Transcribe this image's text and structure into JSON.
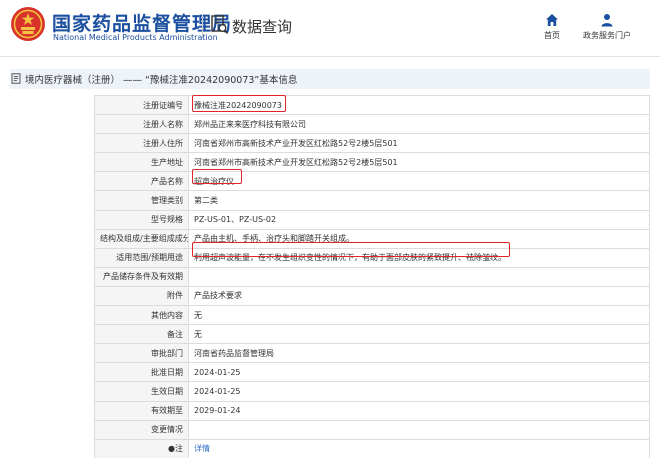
{
  "header": {
    "org_cn": "国家药品监督管理局",
    "org_en": "National Medical Products Administration",
    "query_title": "数据查询",
    "nav": [
      {
        "label": "首页",
        "icon": "home-icon"
      },
      {
        "label": "政务服务门户",
        "icon": "user-icon"
      }
    ]
  },
  "title_bar": {
    "category": "境内医疗器械（注册）",
    "separator": "——",
    "record": "“豫械注准20242090073”",
    "suffix": "基本信息"
  },
  "rows": [
    {
      "label": "注册证编号",
      "value": "豫械注准20242090073"
    },
    {
      "label": "注册人名称",
      "value": "郑州品正来来医疗科技有限公司"
    },
    {
      "label": "注册人住所",
      "value": "河南省郑州市高新技术产业开发区红松路52号2楼5层501"
    },
    {
      "label": "生产地址",
      "value": "河南省郑州市高新技术产业开发区红松路52号2楼5层501"
    },
    {
      "label": "产品名称",
      "value": "超声治疗仪"
    },
    {
      "label": "管理类别",
      "value": "第二类"
    },
    {
      "label": "型号规格",
      "value": "PZ-US-01、PZ-US-02"
    },
    {
      "label": "结构及组成/主要组成成分",
      "value": "产品由主机、手柄、治疗头和脚踏开关组成。"
    },
    {
      "label": "适用范围/预期用途",
      "value": "利用超声波能量，在不发生组织变性的情况下，有助于面部皮肤的紧致提升、祛除皱纹。"
    },
    {
      "label": "产品储存条件及有效期",
      "value": ""
    },
    {
      "label": "附件",
      "value": "产品技术要求"
    },
    {
      "label": "其他内容",
      "value": "无"
    },
    {
      "label": "备注",
      "value": "无"
    },
    {
      "label": "审批部门",
      "value": "河南省药品监督管理局"
    },
    {
      "label": "批准日期",
      "value": "2024-01-25"
    },
    {
      "label": "生效日期",
      "value": "2024-01-25"
    },
    {
      "label": "有效期至",
      "value": "2029-01-24"
    },
    {
      "label": "变更情况",
      "value": ""
    },
    {
      "label": "●注",
      "value": "详情",
      "link": true
    }
  ],
  "colors": {
    "brand_blue": "#1b4fa0",
    "highlight_red": "#e0262b",
    "link_blue": "#2a6bc4",
    "label_bg": "#f5f5f5"
  }
}
